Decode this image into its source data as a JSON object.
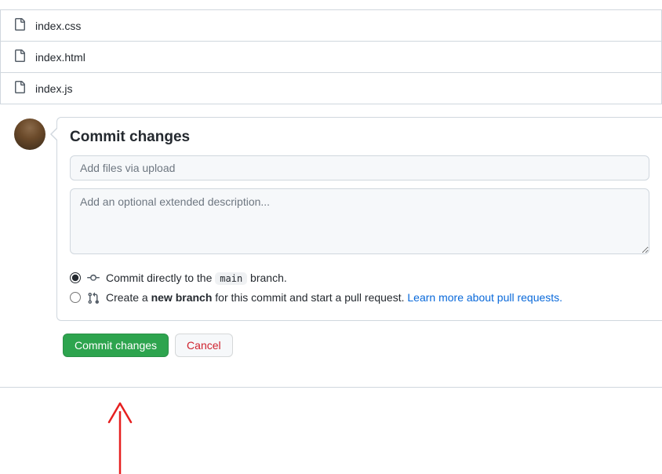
{
  "files": [
    {
      "name": "index.css"
    },
    {
      "name": "index.html"
    },
    {
      "name": "index.js"
    }
  ],
  "commit": {
    "heading": "Commit changes",
    "summary_placeholder": "Add files via upload",
    "summary_value": "",
    "description_placeholder": "Add an optional extended description...",
    "description_value": "",
    "direct_prefix": "Commit directly to the ",
    "direct_branch": "main",
    "direct_suffix": " branch.",
    "newbranch_prefix": "Create a ",
    "newbranch_bold": "new branch",
    "newbranch_suffix": " for this commit and start a pull request. ",
    "learn_link": "Learn more about pull requests.",
    "selected_option": "direct"
  },
  "actions": {
    "commit_label": "Commit changes",
    "cancel_label": "Cancel"
  }
}
